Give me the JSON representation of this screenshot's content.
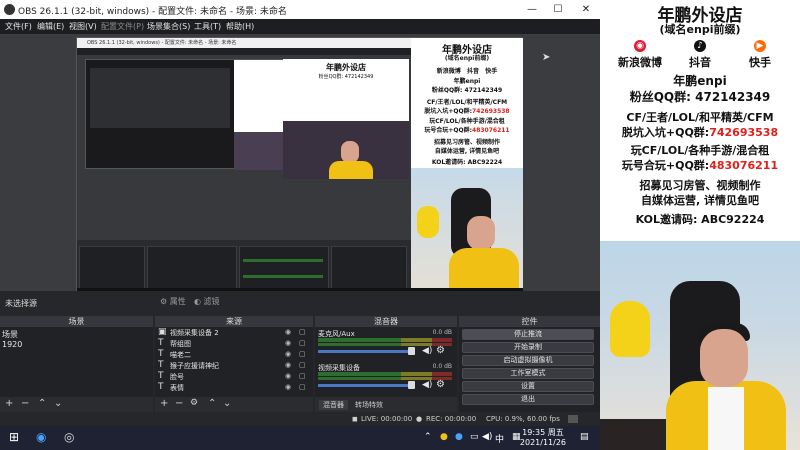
{
  "window": {
    "title": "OBS 26.1.1 (32-bit, windows) - 配置文件: 未命名 - 场景: 未命名",
    "minimize": "—",
    "maximize": "☐",
    "close": "✕"
  },
  "menu": [
    "文件(F)",
    "编辑(E)",
    "视图(V)",
    "配置文件(P)",
    "场景集合(S)",
    "工具(T)",
    "帮助(H)"
  ],
  "mini_obs": {
    "title": "OBS 26.1.1 (32-bit, windows) - 配置文件: 未命名 - 场景: 未命名"
  },
  "info_strip": {
    "no_source": "未选择源",
    "properties": "属性",
    "filters": "滤镜"
  },
  "docks": {
    "scenes": {
      "header": "场景",
      "items": [
        "场景",
        "1920"
      ]
    },
    "sources": {
      "header": "来源",
      "items": [
        {
          "icon": "video-capture-icon",
          "glyph": "▣",
          "label": "视频采集设备 2"
        },
        {
          "icon": "text-icon",
          "glyph": "T",
          "label": "帮组图"
        },
        {
          "icon": "text-icon",
          "glyph": "T",
          "label": "喵老二"
        },
        {
          "icon": "text-icon",
          "glyph": "T",
          "label": "猴子应援请神纪"
        },
        {
          "icon": "text-icon",
          "glyph": "T",
          "label": "脸号"
        },
        {
          "icon": "text-icon",
          "glyph": "T",
          "label": "表情"
        }
      ]
    },
    "mixer": {
      "header": "混音器",
      "channels": [
        {
          "name": "麦克风/Aux",
          "db": "0.0 dB"
        },
        {
          "name": "视频采集设备",
          "db": "0.0 dB"
        }
      ],
      "tabs": [
        "混音器",
        "转场特效"
      ]
    },
    "controls": {
      "header": "控件",
      "buttons": [
        "停止推流",
        "开始录制",
        "启动虚拟摄像机",
        "工作室模式",
        "设置",
        "退出"
      ]
    }
  },
  "status": {
    "live": "LIVE: 00:00:00",
    "rec": "REC: 00:00:00",
    "cpu": "CPU: 0.9%, 60.00 fps"
  },
  "taskbar": {
    "time": "19:35 周五",
    "date": "2021/11/26",
    "ime": "中"
  },
  "overlay": {
    "title": "年鹏外设店",
    "subtitle": "(域名enpi前缀)",
    "socials": [
      {
        "name": "新浪微博",
        "icon": "weibo-icon",
        "color": "#e6162d",
        "glyph": "◉"
      },
      {
        "name": "抖音",
        "icon": "douyin-icon",
        "color": "#111111",
        "glyph": "♪"
      },
      {
        "name": "快手",
        "icon": "kuaishou-icon",
        "color": "#ff6a00",
        "glyph": "▶"
      }
    ],
    "handle": "年鹏enpi",
    "qq_group": "粉丝QQ群: 472142349",
    "line1": "CF/王者/LOL/和平精英/CFM",
    "line2_a": "脱坑入坑+QQ群:",
    "line2_b": "742693538",
    "line3": "玩CF/LOL/各种手游/混合租",
    "line4_a": "玩号合玩+QQ群:",
    "line4_b": "483076211",
    "line5": "招募见习房管、视频制作",
    "line6": "自媒体运营, 详情见鱼吧",
    "line7": "KOL邀请码: ABC92224"
  }
}
